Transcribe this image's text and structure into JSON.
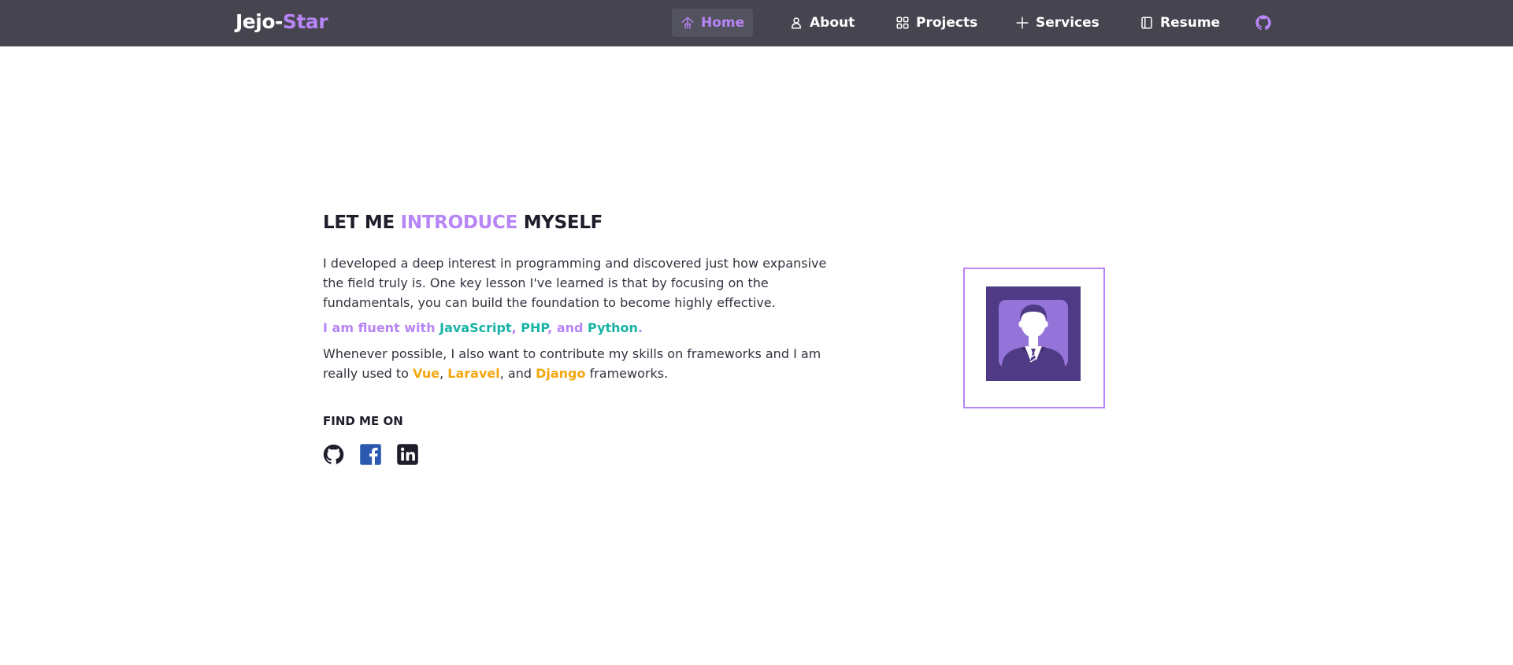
{
  "brand": {
    "prefix": "Jejo-",
    "accent": "Star"
  },
  "nav": {
    "items": [
      {
        "label": "Home",
        "icon": "home-icon",
        "active": true
      },
      {
        "label": "About",
        "icon": "user-icon"
      },
      {
        "label": "Projects",
        "icon": "grid-icon"
      },
      {
        "label": "Services",
        "icon": "plus-icon"
      },
      {
        "label": "Resume",
        "icon": "document-icon"
      }
    ],
    "github_icon": "github-icon"
  },
  "intro": {
    "title_pre": "LET ME ",
    "title_accent": "INTRODUCE",
    "title_post": " MYSELF",
    "paragraph1": "I developed a deep interest in programming and discovered just how expansive the field truly is. One key lesson I've learned is that by focusing on the fundamentals, you can build the foundation to become highly effective.",
    "fluent_pre": "I am fluent with ",
    "lang1": "JavaScript",
    "sep1": ", ",
    "lang2": "PHP",
    "sep2": ", and ",
    "lang3": "Python",
    "fluent_post": ".",
    "frameworks_pre": "Whenever possible, I also want to contribute my skills on frameworks and I am really used to ",
    "fw1": "Vue",
    "fsep1": ", ",
    "fw2": "Laravel",
    "fsep2": ", and ",
    "fw3": "Django",
    "frameworks_post": " frameworks."
  },
  "find_me": {
    "title": "FIND ME ON",
    "links": [
      "github-icon",
      "facebook-icon",
      "linkedin-icon"
    ]
  },
  "avatar": {
    "icon": "businessman-avatar-icon"
  },
  "colors": {
    "navbar_bg": "#46454f",
    "accent": "#b785f5",
    "teal": "#17b3a6",
    "gold": "#f2a811",
    "avatar_bg": "#4f3a86"
  }
}
